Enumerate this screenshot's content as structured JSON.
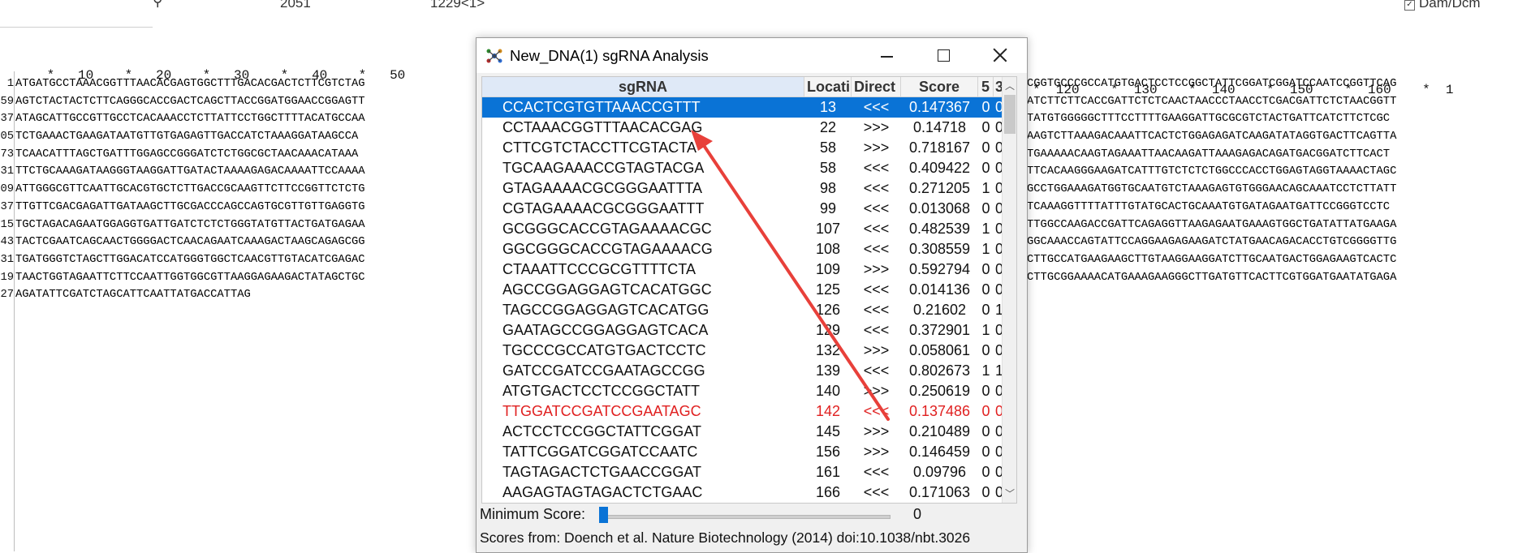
{
  "editor": {
    "top_info_1": "2051",
    "top_info_2": "1229<1>",
    "dam_dcm_label": "Dam/Dcm",
    "ruler_left": "    *   10    *   20    *   30    *   40    *   50",
    "ruler_right": "*  120    *  130    *  140    *  150    *  160    *  1",
    "line_numbers": [
      "1",
      "59",
      "37",
      "05",
      "73",
      "31",
      "09",
      "37",
      "15",
      "43",
      "31",
      "19",
      "27"
    ],
    "left_sequence": [
      "ATGATGCCTAAACGGTTTAACACGAGTGGCTTTGACACGACTCTTCGTCTAG",
      "AGTCTACTACTCTTCAGGGCACCGACTCAGCTTACCGGATGGAACCGGAGTT",
      "ATAGCATTGCCGTTGCCTCACAAACCTCTTATTCCTGGCTTTTACATGCCAA",
      "TCTGAAACTGAAGATAATGTTGTGAGAGTTGACCATCTAAAGGATAAGCCA",
      "TCAACATTTAGCTGATTTGGAGCCGGGATCTCTGGCGCTAACAAACATAAA",
      "TTCTGCAAAGATAAGGGTAAGGATTGATACTAAAAGAGACAAAATTCCAAAA",
      "ATTGGGCGTTCAATTGCACGTGCTCTTGACCGCAAGTTCTTCCGGTTCTCTG",
      "TTGTTCGACGAGATTGATAAGCTTGCGACCCAGCCAGTGCGTTGTTGAGGTG",
      "TGCTAGACAGAATGGAGGTGATTGATCTCTCTGGGTATGTTACTGATGAGAA",
      "TACTCGAATCAGCAACTGGGGACTCAACAGAATCAAAGACTAAGCAGAGCGG",
      "TGATGGGTCTAGCTTGGACATCCATGGGTGGCTCAACGTTGTACATCGAGAC",
      "TAACTGGTAGAATTCTTCCAATTGGTGGCGTTAAGGAGAAGACTATAGCTGC",
      "AGATATTCGATCTAGCATTCAATTATGACCATTAG"
    ],
    "right_sequence": [
      "CGGTGCCCGCCATGTGACTCCTCCGGCTATTCGGATCGGATCCAATCCGGTTCAG",
      "ATCTTCTTCACCGATTCTCTCAACTAACCCTAACCTCGACGATTCTCTAACGGTT",
      "TATGTGGGGGCTTTCCTTTTGAAGGATTGCGCGTCTACTGATTCATCTTCTCGC",
      "AAGTCTTAAAGACAAATTCACTCTGGAGAGATCAAGATATAGGTGACTTCAGTTA",
      "TGAAAAACAAGTAGAAATTAACAAGATTAAAGAGACAGATGACGGATCTTCACT",
      "TTCACAAGGGAAGATCATTTGTCTCTCTGGCCCACCTGGAGTAGGTAAAACTAGC",
      "GCCTGGAAAGATGGTGCAATGTCTAAAGAGTGTGGGAACAGCAAATCCTCTTATT",
      "TCAAAGGTTTTATTTGTATGCACTGCAAATGTGATAGAATGATTCCGGGTCCTC",
      "TTGGCCAAGACCGATTCAGAGGTTAAGAGAATGAAAGTGGCTGATATTATGAAGA",
      "GGCAAACCAGTATTCCAGGAAGAGAAGATCTATGAACAGACACCTGTCGGGGTTG",
      "CTTGCCATGAAGAAGCTTGTAAGGAAGGATCTTGCAATGACTGGAGAAGTCACTC",
      "CTTGCGGAAAACATGAAAGAAGGGCTTGATGTTCACTTCGTGGATGAATATGAGA",
      ""
    ]
  },
  "dialog": {
    "title": "New_DNA(1) sgRNA Analysis",
    "columns": {
      "sgrna": "sgRNA",
      "location": "Locati",
      "direction": "Direct",
      "score": "Score",
      "five": "5",
      "three": "3'"
    },
    "rows": [
      {
        "sgrna": "CCACTCGTGTTAAACCGTTT",
        "location": "13",
        "direction": "<<<",
        "score": "0.147367",
        "five": "0",
        "three": "0"
      },
      {
        "sgrna": "CCTAAACGGTTTAACACGAG",
        "location": "22",
        "direction": ">>>",
        "score": "0.14718",
        "five": "0",
        "three": "0"
      },
      {
        "sgrna": "CTTCGTCTACCTTCGTACTA",
        "location": "58",
        "direction": ">>>",
        "score": "0.718167",
        "five": "0",
        "three": "0"
      },
      {
        "sgrna": "TGCAAGAAACCGTAGTACGA",
        "location": "58",
        "direction": "<<<",
        "score": "0.409422",
        "five": "0",
        "three": "0"
      },
      {
        "sgrna": "GTAGAAAACGCGGGAATTTA",
        "location": "98",
        "direction": "<<<",
        "score": "0.271205",
        "five": "1",
        "three": "0"
      },
      {
        "sgrna": "CGTAGAAAACGCGGGAATTT",
        "location": "99",
        "direction": "<<<",
        "score": "0.013068",
        "five": "0",
        "three": "0"
      },
      {
        "sgrna": "GCGGGCACCGTAGAAAACGC",
        "location": "107",
        "direction": "<<<",
        "score": "0.482539",
        "five": "1",
        "three": "0"
      },
      {
        "sgrna": "GGCGGGCACCGTAGAAAACG",
        "location": "108",
        "direction": "<<<",
        "score": "0.308559",
        "five": "1",
        "three": "0"
      },
      {
        "sgrna": "CTAAATTCCCGCGTTTTCTA",
        "location": "109",
        "direction": ">>>",
        "score": "0.592794",
        "five": "0",
        "three": "0"
      },
      {
        "sgrna": "AGCCGGAGGAGTCACATGGC",
        "location": "125",
        "direction": "<<<",
        "score": "0.014136",
        "five": "0",
        "three": "0"
      },
      {
        "sgrna": "TAGCCGGAGGAGTCACATGG",
        "location": "126",
        "direction": "<<<",
        "score": "0.21602",
        "five": "0",
        "three": "1"
      },
      {
        "sgrna": "GAATAGCCGGAGGAGTCACA",
        "location": "129",
        "direction": "<<<",
        "score": "0.372901",
        "five": "1",
        "three": "0"
      },
      {
        "sgrna": "TGCCCGCCATGTGACTCCTC",
        "location": "132",
        "direction": ">>>",
        "score": "0.058061",
        "five": "0",
        "three": "0"
      },
      {
        "sgrna": "GATCCGATCCGAATAGCCGG",
        "location": "139",
        "direction": "<<<",
        "score": "0.802673",
        "five": "1",
        "three": "1"
      },
      {
        "sgrna": "ATGTGACTCCTCCGGCTATT",
        "location": "140",
        "direction": ">>>",
        "score": "0.250619",
        "five": "0",
        "three": "0"
      },
      {
        "sgrna": "TTGGATCCGATCCGAATAGC",
        "location": "142",
        "direction": "<<<",
        "score": "0.137486",
        "five": "0",
        "three": "0"
      },
      {
        "sgrna": "ACTCCTCCGGCTATTCGGAT",
        "location": "145",
        "direction": ">>>",
        "score": "0.210489",
        "five": "0",
        "three": "0"
      },
      {
        "sgrna": "TATTCGGATCGGATCCAATC",
        "location": "156",
        "direction": ">>>",
        "score": "0.146459",
        "five": "0",
        "three": "0"
      },
      {
        "sgrna": "TAGTAGACTCTGAACCGGAT",
        "location": "161",
        "direction": "<<<",
        "score": "0.09796",
        "five": "0",
        "three": "0"
      },
      {
        "sgrna": "AAGAGTAGTAGACTCTGAAC",
        "location": "166",
        "direction": "<<<",
        "score": "0.171063",
        "five": "0",
        "three": "0"
      }
    ],
    "selected_row_index": 0,
    "highlighted_row_index": 15,
    "min_score_label": "Minimum Score:",
    "min_score_value": "0",
    "footer": "Scores from: Doench et al. Nature Biotechnology (2014) doi:10.1038/nbt.3026"
  },
  "colors": {
    "selection": "#0a73d6",
    "highlight_text": "#e02020",
    "annotation_arrow": "#e8403a"
  }
}
